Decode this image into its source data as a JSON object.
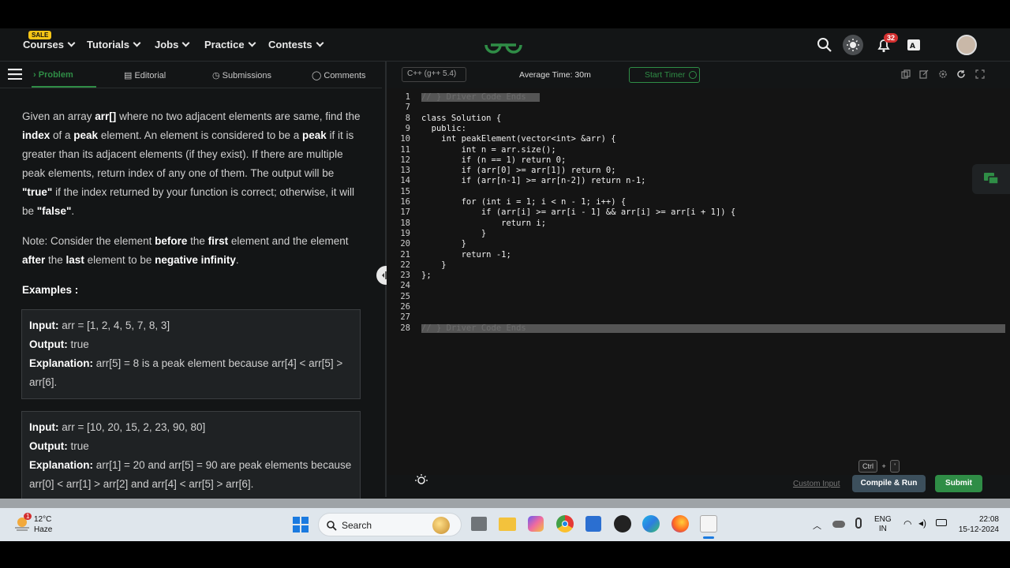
{
  "nav": {
    "sale": "SALE",
    "items": [
      "Courses",
      "Tutorials",
      "Jobs",
      "Practice",
      "Contests"
    ],
    "notifications": "32"
  },
  "tabs": {
    "problem": "Problem",
    "editorial": "Editorial",
    "submissions": "Submissions",
    "comments": "Comments"
  },
  "problem": {
    "p1": [
      {
        "t": "Given an array ",
        "b": false
      },
      {
        "t": "arr[]",
        "b": true
      },
      {
        "t": " where no two adjacent elements are same, find the ",
        "b": false
      },
      {
        "t": "index",
        "b": true
      },
      {
        "t": " of a ",
        "b": false
      },
      {
        "t": "peak",
        "b": true
      },
      {
        "t": " element. An element is considered to be a ",
        "b": false
      },
      {
        "t": "peak",
        "b": true
      },
      {
        "t": " if it is greater than its adjacent elements (if they exist). If there are multiple peak elements, return index of any one of them. The output will be ",
        "b": false
      },
      {
        "t": "\"true\"",
        "b": true
      },
      {
        "t": " if the index returned by your function is correct; otherwise, it will be ",
        "b": false
      },
      {
        "t": "\"false\"",
        "b": true
      },
      {
        "t": ".",
        "b": false
      }
    ],
    "p2": [
      {
        "t": "Note: Consider the element ",
        "b": false
      },
      {
        "t": "before",
        "b": true
      },
      {
        "t": " the ",
        "b": false
      },
      {
        "t": "first",
        "b": true
      },
      {
        "t": " element and the element ",
        "b": false
      },
      {
        "t": "after",
        "b": true
      },
      {
        "t": " the ",
        "b": false
      },
      {
        "t": "last",
        "b": true
      },
      {
        "t": " element to be ",
        "b": false
      },
      {
        "t": "negative infinity",
        "b": true
      },
      {
        "t": ".",
        "b": false
      }
    ],
    "examples_heading": "Examples :",
    "ex1": {
      "input_label": "Input:",
      "input": " arr = [1, 2, 4, 5, 7, 8, 3]",
      "output_label": "Output:",
      "output": " true",
      "explanation_label": "Explanation:",
      "explanation": " arr[5] = 8 is a peak element because arr[4] < arr[5] > arr[6]."
    },
    "ex2": {
      "input_label": "Input:",
      "input": " arr = [10, 20, 15, 2, 23, 90, 80]",
      "output_label": "Output:",
      "output": " true",
      "explanation_label": "Explanation:",
      "explanation": " arr[1] = 20 and arr[5] = 90 are peak elements because arr[0] < arr[1] > arr[2] and arr[4] < arr[5] > arr[6]."
    }
  },
  "editor": {
    "language": "C++ (g++ 5.4)",
    "avg_time": "Average Time: 30m",
    "start_timer": "Start Timer",
    "lines": [
      {
        "n": "1",
        "folded": true,
        "t": "// } Driver Code Ends"
      },
      {
        "n": "7",
        "t": ""
      },
      {
        "n": "8",
        "t": "class Solution {"
      },
      {
        "n": "9",
        "t": "  public:"
      },
      {
        "n": "10",
        "t": "    int peakElement(vector<int> &arr) {"
      },
      {
        "n": "11",
        "t": "        int n = arr.size();"
      },
      {
        "n": "12",
        "t": "        if (n == 1) return 0;"
      },
      {
        "n": "13",
        "t": "        if (arr[0] >= arr[1]) return 0;"
      },
      {
        "n": "14",
        "t": "        if (arr[n-1] >= arr[n-2]) return n-1;"
      },
      {
        "n": "15",
        "t": ""
      },
      {
        "n": "16",
        "t": "        for (int i = 1; i < n - 1; i++) {"
      },
      {
        "n": "17",
        "t": "            if (arr[i] >= arr[i - 1] && arr[i] >= arr[i + 1]) {"
      },
      {
        "n": "18",
        "t": "                return i;"
      },
      {
        "n": "19",
        "t": "            }"
      },
      {
        "n": "20",
        "t": "        }"
      },
      {
        "n": "21",
        "t": "        return -1;"
      },
      {
        "n": "22",
        "t": "    }"
      },
      {
        "n": "23",
        "t": "};"
      },
      {
        "n": "24",
        "t": ""
      },
      {
        "n": "25",
        "t": ""
      },
      {
        "n": "26",
        "t": ""
      },
      {
        "n": "27",
        "t": ""
      },
      {
        "n": "28",
        "folded": true,
        "t": "// } Driver Code Ends"
      }
    ],
    "ctrl_key": "Ctrl",
    "plus": "+",
    "quote_key": "'",
    "custom_input": "Custom Input",
    "compile_run": "Compile & Run",
    "submit": "Submit"
  },
  "taskbar": {
    "weather_temp": "12°C",
    "weather_desc": "Haze",
    "weather_badge": "1",
    "search": "Search",
    "lang1": "ENG",
    "lang2": "IN",
    "time": "22:08",
    "date": "15-12-2024"
  },
  "colors": {
    "accent": "#2f8d46",
    "bg": "#131516",
    "badge": "#d32f2f"
  }
}
